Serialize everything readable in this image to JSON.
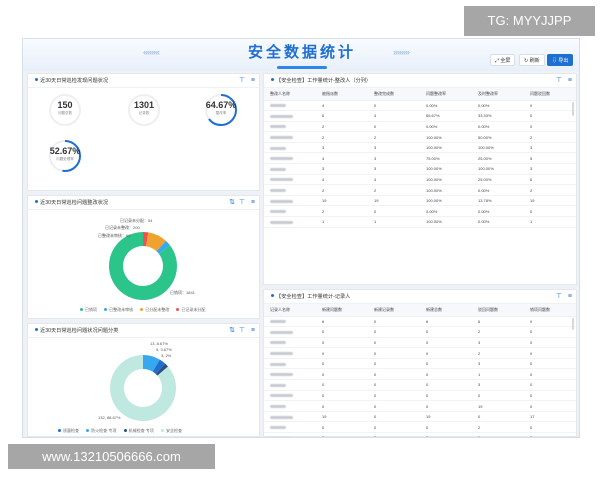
{
  "watermark": {
    "top": "TG: MYYJJPP",
    "bottom": "www.13210506666.com"
  },
  "header": {
    "title": "安全数据统计",
    "buttons": [
      {
        "label": "全屏",
        "icon": "expand-icon"
      },
      {
        "label": "刷新",
        "icon": "refresh-icon"
      },
      {
        "label": "导出",
        "icon": "export-icon"
      }
    ]
  },
  "colors": {
    "accent": "#1f6fd1",
    "green": "#2bc48a",
    "teal": "#bfe8e0",
    "lightblue": "#37a8ef"
  },
  "panel1": {
    "title": "近30天日常巡检发现问题状况",
    "stats": [
      {
        "value": "150",
        "label": "问题总数"
      },
      {
        "value": "1301",
        "label": "记录数"
      },
      {
        "value": "64.67%",
        "label": "整改率",
        "progress": 0.6467
      },
      {
        "value": "52.67%",
        "label": "问题处理率",
        "progress": 0.5267
      }
    ]
  },
  "panel2": {
    "title": "近30天日常巡检问题整改状况",
    "labels": [
      "已记录未分配：54",
      "已记录未整改：200",
      "已整改未审核：60",
      "已销项：1841"
    ],
    "legend": [
      {
        "label": "已销项",
        "color": "#2bc48a"
      },
      {
        "label": "已整改未审核",
        "color": "#37a8ef"
      },
      {
        "label": "已分配未整改",
        "color": "#f0a22e"
      },
      {
        "label": "已记录未分配",
        "color": "#ef5350"
      }
    ]
  },
  "panel3": {
    "title": "近30天日常巡检问题状况问题分类",
    "labels": [
      "13, 8.67%",
      "5, 3.67%",
      "3, 2%",
      "132, 88.67%"
    ],
    "legend": [
      {
        "label": "质量检查",
        "color": "#1f6fd1"
      },
      {
        "label": "防火检查·专项",
        "color": "#37a8ef"
      },
      {
        "label": "机械检查·专项",
        "color": "#2f4f7f"
      },
      {
        "label": "安全检查",
        "color": "#bfe8e0"
      }
    ]
  },
  "table1": {
    "title": "【安全检查】工作量统计-整改人（分列）",
    "headers": [
      "整改人名称",
      "被指派数",
      "整改完成数",
      "问题整改率",
      "及时整改率",
      "问题驳回数"
    ],
    "rows": [
      [
        "",
        "4",
        "0",
        "0.00%",
        "0.00%",
        "0"
      ],
      [
        "",
        "6",
        "4",
        "66.67%",
        "33.33%",
        "0"
      ],
      [
        "",
        "2",
        "0",
        "0.00%",
        "0.00%",
        "0"
      ],
      [
        "",
        "2",
        "2",
        "100.00%",
        "50.00%",
        "2"
      ],
      [
        "",
        "3",
        "3",
        "100.00%",
        "100.00%",
        "3"
      ],
      [
        "",
        "4",
        "3",
        "75.00%",
        "25.00%",
        "5"
      ],
      [
        "",
        "3",
        "3",
        "100.00%",
        "100.00%",
        "3"
      ],
      [
        "",
        "4",
        "4",
        "100.00%",
        "25.00%",
        "6"
      ],
      [
        "",
        "2",
        "2",
        "100.00%",
        "0.00%",
        "2"
      ],
      [
        "",
        "19",
        "19",
        "100.00%",
        "13.78%",
        "19"
      ],
      [
        "",
        "2",
        "0",
        "0.00%",
        "0.00%",
        "0"
      ],
      [
        "",
        "1",
        "1",
        "100.00%",
        "0.00%",
        "1"
      ]
    ]
  },
  "table2": {
    "title": "【安全检查】工作量统计-记录人",
    "headers": [
      "记录人名称",
      "新建问题数",
      "新建记录数",
      "新建总数",
      "驳回问题数",
      "销项问题数"
    ],
    "rows": [
      [
        "",
        "6",
        "0",
        "6",
        "6",
        "0"
      ],
      [
        "",
        "0",
        "0",
        "0",
        "2",
        "0"
      ],
      [
        "",
        "0",
        "0",
        "0",
        "3",
        "0"
      ],
      [
        "",
        "0",
        "0",
        "0",
        "2",
        "0"
      ],
      [
        "",
        "0",
        "0",
        "0",
        "3",
        "0"
      ],
      [
        "",
        "0",
        "0",
        "0",
        "1",
        "0"
      ],
      [
        "",
        "0",
        "0",
        "0",
        "3",
        "0"
      ],
      [
        "",
        "0",
        "0",
        "0",
        "0",
        "0"
      ],
      [
        "",
        "0",
        "0",
        "0",
        "19",
        "0"
      ],
      [
        "",
        "19",
        "0",
        "19",
        "0",
        "17"
      ],
      [
        "",
        "0",
        "0",
        "0",
        "2",
        "0"
      ],
      [
        "",
        "0",
        "0",
        "0",
        "1",
        "0"
      ]
    ]
  }
}
